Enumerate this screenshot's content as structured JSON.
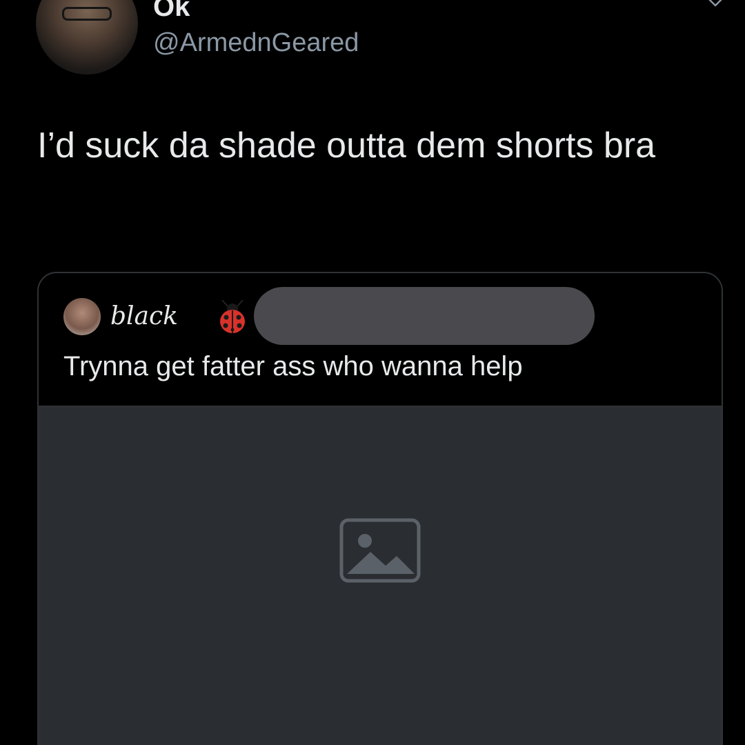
{
  "tweet": {
    "display_name": "Ok",
    "handle": "@ArmednGeared",
    "text": "I’d suck da shade outta dem shorts bra"
  },
  "icons": {
    "menu": "chevron-down-icon",
    "quote_emoji": "ladybug-icon",
    "media": "image-placeholder-icon"
  },
  "quoted_tweet": {
    "display_name": "black",
    "text": "Trynna get fatter ass who wanna help",
    "handle_redacted": true
  },
  "colors": {
    "background": "#000000",
    "text": "#e7e9ea",
    "muted": "#8b98a5",
    "border": "#2f3336",
    "redaction": "#4a4a4e"
  }
}
